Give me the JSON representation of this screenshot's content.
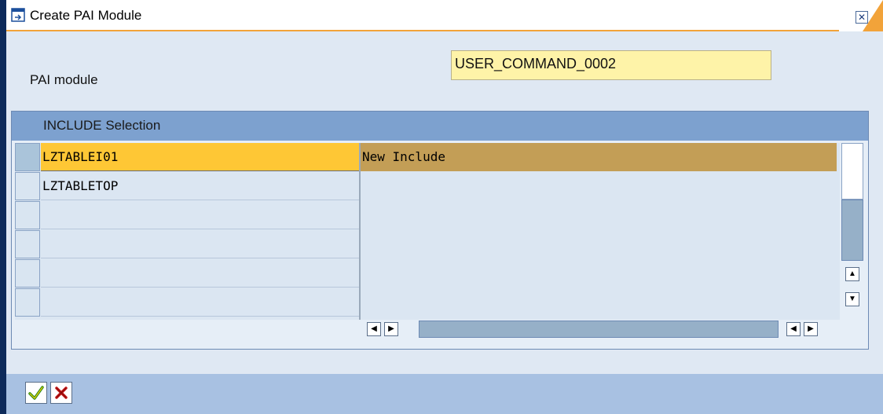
{
  "window": {
    "title": "Create PAI Module",
    "close_label": "✕"
  },
  "form": {
    "pai_module_label": "PAI module",
    "pai_module_value": "USER_COMMAND_0002"
  },
  "table": {
    "title": "INCLUDE Selection",
    "rows": [
      {
        "name": "LZTABLEI01",
        "description": "New Include",
        "selected": true
      },
      {
        "name": "LZTABLETOP",
        "description": "",
        "selected": false
      },
      {
        "name": "",
        "description": "",
        "selected": false
      },
      {
        "name": "",
        "description": "",
        "selected": false
      },
      {
        "name": "",
        "description": "",
        "selected": false
      },
      {
        "name": "",
        "description": "",
        "selected": false
      }
    ]
  },
  "icons": {
    "title": "create-object-icon",
    "close": "close-icon",
    "confirm": "checkmark-icon",
    "cancel": "cancel-x-icon"
  },
  "colors": {
    "accent": "#f2a33a",
    "input_bg": "#fef3a8",
    "selected_row": "#fec735",
    "header_bar": "#7da1cf",
    "footer_bar": "#a8c1e2"
  }
}
